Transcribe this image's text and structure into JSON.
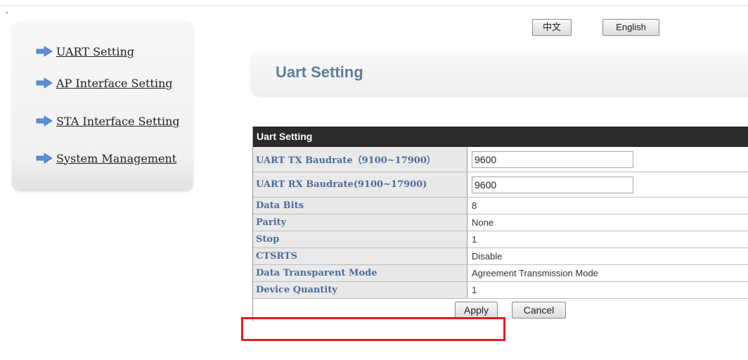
{
  "language": {
    "chinese_label": "中文",
    "english_label": "English"
  },
  "sidebar": {
    "items": [
      {
        "label": "UART Setting",
        "icon": "arrow-right-icon"
      },
      {
        "label": "AP Interface Setting",
        "icon": "arrow-right-icon"
      },
      {
        "label": "STA Interface Setting",
        "icon": "arrow-right-icon"
      },
      {
        "label": "System Management",
        "icon": "arrow-right-icon"
      }
    ]
  },
  "page": {
    "title": "Uart Setting"
  },
  "table": {
    "header": "Uart Setting",
    "rows": [
      {
        "label": "UART TX Baudrate（9100~17900）",
        "value": "9600",
        "type": "input"
      },
      {
        "label": "UART RX Baudrate(9100~17900)",
        "value": "9600",
        "type": "input"
      },
      {
        "label": "Data Bits",
        "value": "8",
        "type": "text"
      },
      {
        "label": "Parity",
        "value": "None",
        "type": "text"
      },
      {
        "label": "Stop",
        "value": "1",
        "type": "text"
      },
      {
        "label": "CTSRTS",
        "value": "Disable",
        "type": "text"
      },
      {
        "label": "Data Transparent Mode",
        "value": "Agreement Transmission Mode",
        "type": "text"
      },
      {
        "label": "Device Quantity",
        "value": "1",
        "type": "text"
      }
    ]
  },
  "actions": {
    "apply_label": "Apply",
    "cancel_label": "Cancel"
  },
  "colors": {
    "highlight": "#e01e1e",
    "label_text": "#4d6c9a",
    "title_text": "#5f7e9e",
    "header_bg": "#2b2b2b",
    "arrow": "#5b8fd6"
  }
}
